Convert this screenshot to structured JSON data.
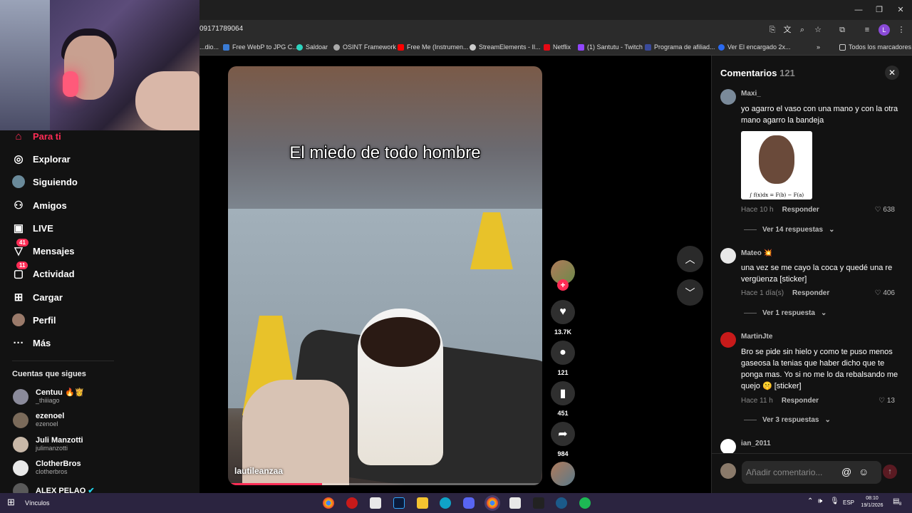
{
  "browser": {
    "url": "09171789064",
    "bookmarks": [
      {
        "label": "...dio...",
        "color": "#666666"
      },
      {
        "label": "Free WebP to JPG C...",
        "color": "#3a7bd5"
      },
      {
        "label": "Saldoar",
        "color": "#2dd4bf"
      },
      {
        "label": "OSINT Framework",
        "color": "#aaaaaa"
      },
      {
        "label": "Free Me (Instrumen...",
        "color": "#ff0000"
      },
      {
        "label": "StreamElements - Il...",
        "color": "#cccccc"
      },
      {
        "label": "Netflix",
        "color": "#e50914"
      },
      {
        "label": "(1) Santutu - Twitch",
        "color": "#9146ff"
      },
      {
        "label": "Programa de afiliad...",
        "color": "#3a4a9a"
      },
      {
        "label": "Ver El encargado 2x...",
        "color": "#2a6af0"
      }
    ],
    "all_bookmarks": "Todos los marcadores",
    "profile_initial": "L"
  },
  "sidebar": {
    "nav": [
      {
        "label": "Para ti",
        "icon": "home-icon",
        "active": true
      },
      {
        "label": "Explorar",
        "icon": "compass-icon"
      },
      {
        "label": "Siguiendo",
        "icon": "following-avatar-icon"
      },
      {
        "label": "Amigos",
        "icon": "friends-icon"
      },
      {
        "label": "LIVE",
        "icon": "live-icon"
      },
      {
        "label": "Mensajes",
        "icon": "messages-icon",
        "badge": "41"
      },
      {
        "label": "Actividad",
        "icon": "activity-icon",
        "badge": "11"
      },
      {
        "label": "Cargar",
        "icon": "upload-icon"
      },
      {
        "label": "Perfil",
        "icon": "profile-avatar-icon"
      },
      {
        "label": "Más",
        "icon": "more-icon"
      }
    ],
    "following_title": "Cuentas que sigues",
    "following": [
      {
        "name": "Centuu 🔥👸",
        "user": "_thiiiago"
      },
      {
        "name": "ezenoel",
        "user": "ezenoel"
      },
      {
        "name": "Juli Manzotti",
        "user": "julimanzotti"
      },
      {
        "name": "ClotherBros",
        "user": "clotherbros"
      },
      {
        "name": "ALEX PELAO",
        "user": ""
      }
    ]
  },
  "video": {
    "caption": "El miedo de todo hombre",
    "author": "lautileanzaa",
    "progress": 0.3
  },
  "actions": {
    "likes": "13.7K",
    "comments": "121",
    "saves": "451",
    "shares": "984"
  },
  "comments_panel": {
    "title": "Comentarios",
    "count": "121",
    "input_placeholder": "Añadir comentario...",
    "comments": [
      {
        "user": "Maxi_",
        "text": "yo agarro el vaso con una mano y con la otra mano agarro la bandeja",
        "time": "Hace 10 h",
        "reply": "Responder",
        "likes": "638",
        "replies": "Ver 14 respuestas",
        "meme_formula": "∫ f(x)dx = F(b) − F(a)"
      },
      {
        "user": "Mateo 💥",
        "text": "una vez se me cayo la coca y quedé una re vergüenza [sticker]",
        "time": "Hace 1 día(s)",
        "reply": "Responder",
        "likes": "406",
        "replies": "Ver 1 respuesta"
      },
      {
        "user": "MartinJte",
        "text": "Bro se pide sin hielo y como te puso menos gaseosa la tenias que haber dicho que te ponga mas. Yo si no me lo da rebalsando me quejo 🤫 [sticker]",
        "time": "Hace 11 h",
        "reply": "Responder",
        "likes": "13",
        "replies": "Ver 3 respuestas"
      },
      {
        "user": "ian_2011"
      }
    ]
  },
  "taskbar": {
    "search": "Vínculos",
    "lang": "ESP",
    "time": "08:10",
    "date": "19/1/2026",
    "notif": "8"
  }
}
